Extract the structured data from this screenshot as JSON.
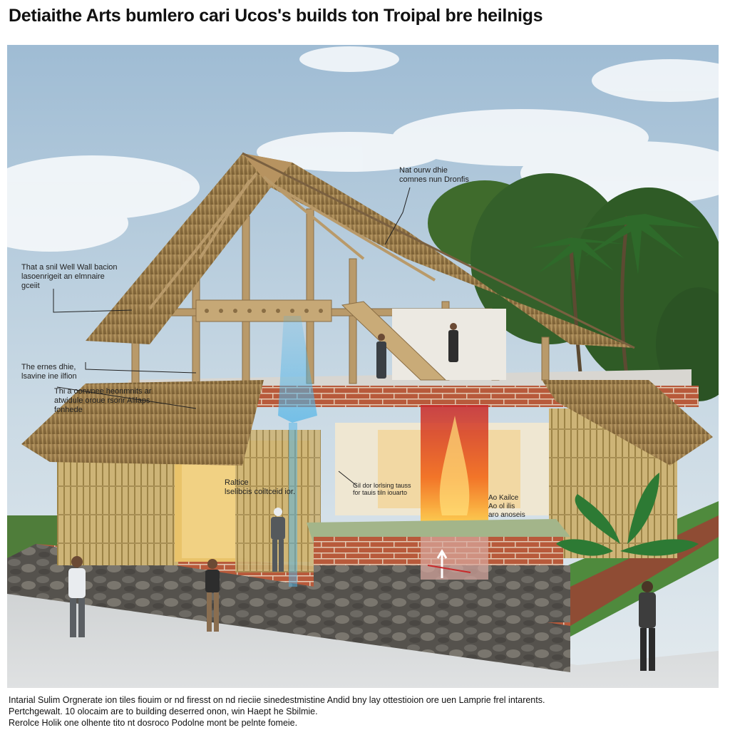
{
  "title": "Detiaithe Arts bumlero cari Ucos's builds ton Troipal bre heilnigs",
  "annotations": {
    "roof": [
      "Nat ourw dhie",
      "comnes nun Dronfis"
    ],
    "wall": [
      "That a snil Well Wall bacion",
      "lasoenrigeit an elmnaire",
      "gceiit"
    ],
    "roof_lower": [
      "The ernes dhie,",
      "lsavine ine ilfion"
    ],
    "eave": [
      "Thi a oorwnee heonmnits ar",
      "atwidule oroue rsonr Alilaps",
      "fonhede"
    ],
    "interior": [
      "Raltice",
      "lselibcis coiltceid ior."
    ],
    "hearth": [
      "Gil dor lorlsing tauss",
      "for tauis tiln iouarto"
    ],
    "side": [
      "Ao Kailce",
      "Ao ol ilis",
      "aro anoseis"
    ]
  },
  "caption": [
    "Intarial Sulim Orgnerate ion tiles fiouim or nd firesst on nd rieciie sinedestmistine Andid bny lay ottestioion ore uen Lamprie frel intarents.",
    "Pertchgewalt. 10 olocaim are to building deserred onon, win Haept he Sbilmie.",
    "Rerolce Holik one olhente tito nt dosroco Podolne mont be pelnte fomeie."
  ]
}
